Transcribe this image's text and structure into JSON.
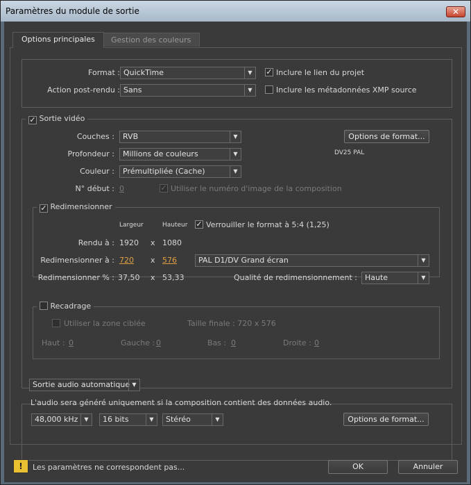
{
  "window": {
    "title": "Paramètres du module de sortie",
    "close_glyph": "✕"
  },
  "tabs": {
    "main": "Options principales",
    "color": "Gestion des couleurs"
  },
  "top": {
    "format_label": "Format :",
    "format_value": "QuickTime",
    "post_label": "Action post-rendu :",
    "post_value": "Sans",
    "include_project_link": "Inclure le lien du projet",
    "include_project_link_checked": true,
    "include_xmp": "Inclure les métadonnées XMP source",
    "include_xmp_checked": false
  },
  "video": {
    "legend": "Sortie vidéo",
    "checked": true,
    "channels_label": "Couches :",
    "channels_value": "RVB",
    "depth_label": "Profondeur :",
    "depth_value": "Millions de couleurs",
    "color_label": "Couleur :",
    "color_value": "Prémultipliée (Cache)",
    "start_label": "N° début :",
    "start_value": "0",
    "use_comp_frame": "Utiliser le numéro d'image de la composition",
    "format_options_button": "Options de format...",
    "codec_info": "DV25 PAL"
  },
  "resize": {
    "legend": "Redimensionner",
    "checked": true,
    "width_header": "Largeur",
    "height_header": "Hauteur",
    "lock_aspect": "Verrouiller le format à 5:4 (1,25)",
    "lock_checked": true,
    "render_label": "Rendu à :",
    "render_w": "1920",
    "render_h": "1080",
    "x": "x",
    "resize_to_label": "Redimensionner à :",
    "resize_w": "720",
    "resize_h": "576",
    "preset_value": "PAL D1/DV Grand écran",
    "percent_label": "Redimensionner % :",
    "percent_w": "37,50",
    "percent_h": "53,33",
    "quality_label": "Qualité de redimensionnement :",
    "quality_value": "Haute"
  },
  "crop": {
    "legend": "Recadrage",
    "checked": false,
    "use_roi": "Utiliser la zone ciblée",
    "final_size": "Taille finale : 720 x 576",
    "top_label": "Haut :",
    "top_value": "0",
    "left_label": "Gauche :",
    "left_value": "0",
    "bottom_label": "Bas :",
    "bottom_value": "0",
    "right_label": "Droite :",
    "right_value": "0"
  },
  "audio": {
    "mode_value": "Sortie audio automatique",
    "note": "L'audio sera généré uniquement si la composition contient des données audio.",
    "rate_value": "48,000 kHz",
    "bits_value": "16 bits",
    "channels_value": "Stéréo",
    "format_options_button": "Options de format..."
  },
  "footer": {
    "warning_glyph": "!",
    "warning_text": "Les paramètres ne correspondent pas...",
    "ok_button": "OK",
    "cancel_button": "Annuler"
  },
  "glyphs": {
    "arrow": "▼",
    "check": "✓"
  },
  "icons": [
    "close-icon",
    "warning-icon",
    "dropdown-arrow-icon",
    "checkmark-icon"
  ]
}
